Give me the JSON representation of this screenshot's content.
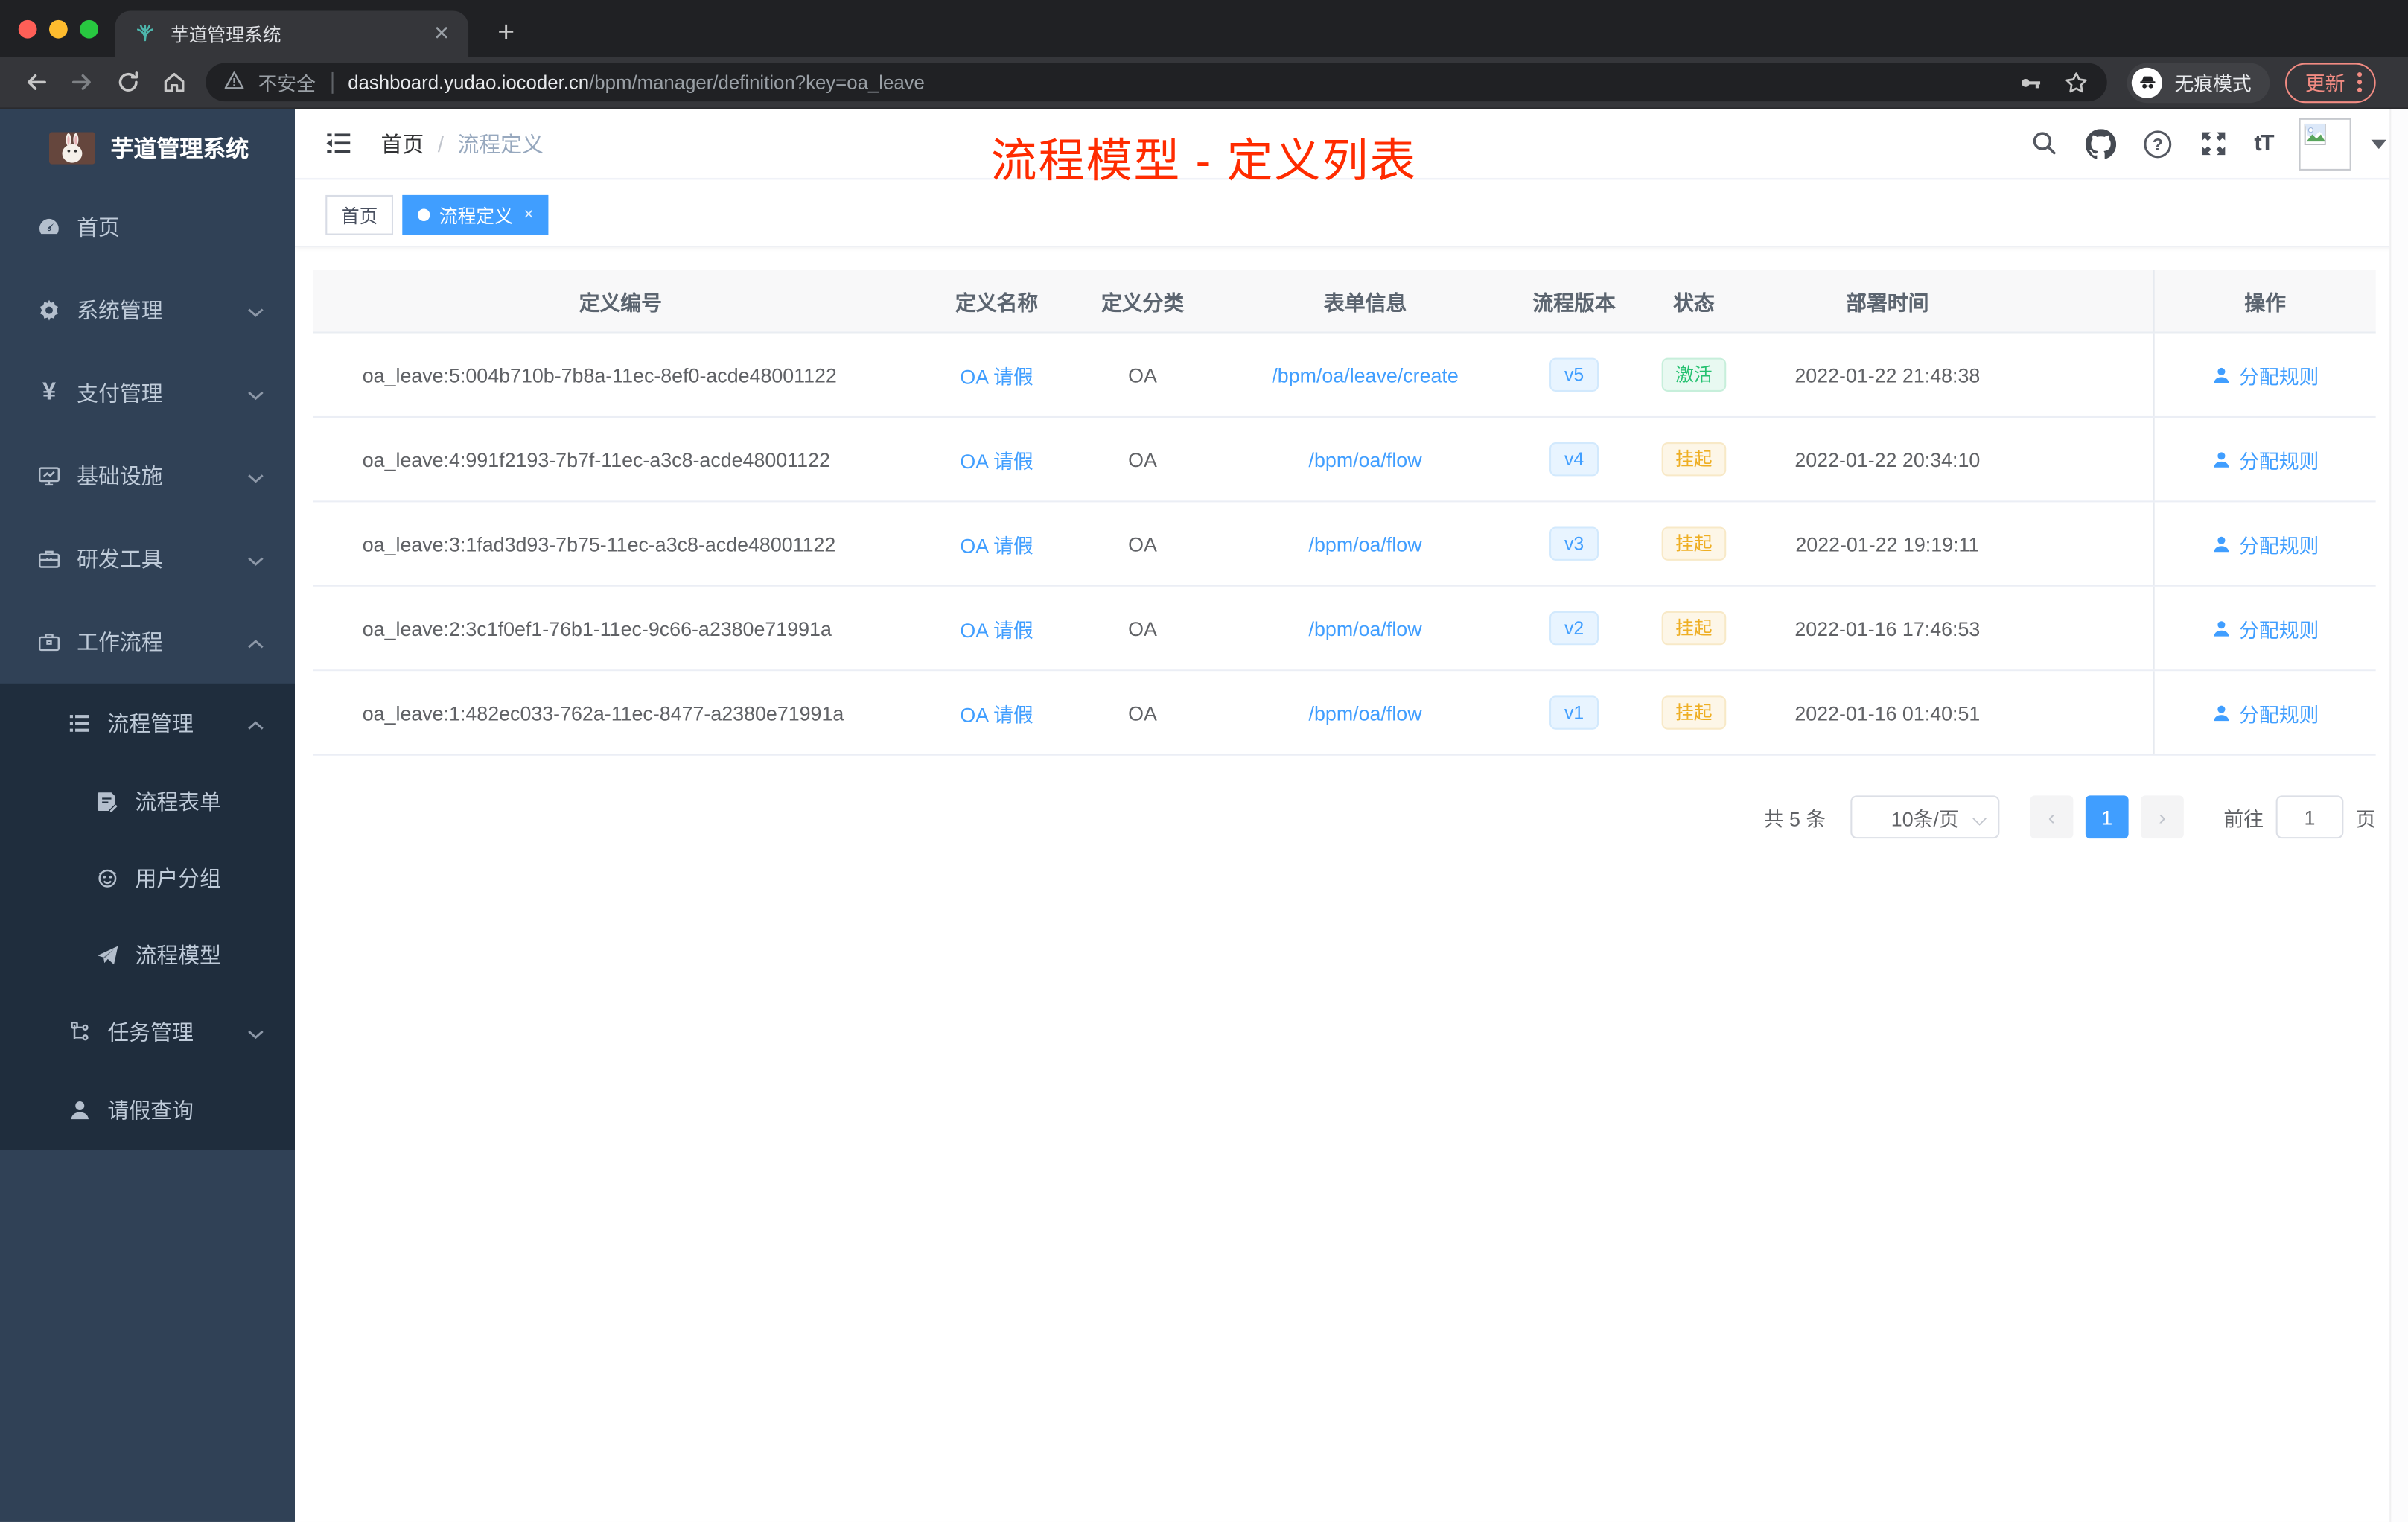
{
  "browser": {
    "tab_title": "芋道管理系统",
    "new_tab_label": "+",
    "close_tab_label": "✕",
    "security_label": "不安全",
    "url_host": "dashboard.yudao.iocoder.cn",
    "url_path": "/bpm/manager/definition?key=oa_leave",
    "incognito_label": "无痕模式",
    "update_label": "更新"
  },
  "sidebar": {
    "logo_title": "芋道管理系统",
    "items": [
      {
        "label": "首页",
        "icon": "dashboard-icon"
      },
      {
        "label": "系统管理",
        "icon": "gear-icon"
      },
      {
        "label": "支付管理",
        "icon": "yen-icon"
      },
      {
        "label": "基础设施",
        "icon": "monitor-icon"
      },
      {
        "label": "研发工具",
        "icon": "toolbox-icon"
      },
      {
        "label": "工作流程",
        "icon": "briefcase-icon"
      }
    ],
    "workflow_children": [
      {
        "label": "流程管理",
        "icon": "tree-list-icon"
      },
      {
        "label": "流程表单",
        "icon": "form-edit-icon"
      },
      {
        "label": "用户分组",
        "icon": "user-group-icon"
      },
      {
        "label": "流程模型",
        "icon": "paper-plane-icon"
      },
      {
        "label": "任务管理",
        "icon": "org-tree-icon"
      },
      {
        "label": "请假查询",
        "icon": "person-icon"
      }
    ]
  },
  "header": {
    "breadcrumb_home": "首页",
    "breadcrumb_sep": "/",
    "breadcrumb_current": "流程定义",
    "annotation": "流程模型 - 定义列表",
    "font_size_icon_text": "tT"
  },
  "tags": {
    "home": "首页",
    "active": "流程定义",
    "active_close": "×"
  },
  "table": {
    "columns": [
      "定义编号",
      "定义名称",
      "定义分类",
      "表单信息",
      "流程版本",
      "状态",
      "部署时间",
      "操作"
    ],
    "rows": [
      {
        "id": "oa_leave:5:004b710b-7b8a-11ec-8ef0-acde48001122",
        "name": "OA 请假",
        "category": "OA",
        "form": "/bpm/oa/leave/create",
        "version": "v5",
        "status": "激活",
        "status_type": "success",
        "deployed": "2022-01-22 21:48:38",
        "action": "分配规则"
      },
      {
        "id": "oa_leave:4:991f2193-7b7f-11ec-a3c8-acde48001122",
        "name": "OA 请假",
        "category": "OA",
        "form": "/bpm/oa/flow",
        "version": "v4",
        "status": "挂起",
        "status_type": "warning",
        "deployed": "2022-01-22 20:34:10",
        "action": "分配规则"
      },
      {
        "id": "oa_leave:3:1fad3d93-7b75-11ec-a3c8-acde48001122",
        "name": "OA 请假",
        "category": "OA",
        "form": "/bpm/oa/flow",
        "version": "v3",
        "status": "挂起",
        "status_type": "warning",
        "deployed": "2022-01-22 19:19:11",
        "action": "分配规则"
      },
      {
        "id": "oa_leave:2:3c1f0ef1-76b1-11ec-9c66-a2380e71991a",
        "name": "OA 请假",
        "category": "OA",
        "form": "/bpm/oa/flow",
        "version": "v2",
        "status": "挂起",
        "status_type": "warning",
        "deployed": "2022-01-16 17:46:53",
        "action": "分配规则"
      },
      {
        "id": "oa_leave:1:482ec033-762a-11ec-8477-a2380e71991a",
        "name": "OA 请假",
        "category": "OA",
        "form": "/bpm/oa/flow",
        "version": "v1",
        "status": "挂起",
        "status_type": "warning",
        "deployed": "2022-01-16 01:40:51",
        "action": "分配规则"
      }
    ]
  },
  "pagination": {
    "total": "共 5 条",
    "page_size": "10条/页",
    "prev": "‹",
    "current": "1",
    "next": "›",
    "goto_label": "前往",
    "goto_value": "1",
    "page_label": "页"
  },
  "colors": {
    "accent": "#409eff",
    "annotation_red": "#ff2b00",
    "sidebar_bg": "#304156",
    "submenu_bg": "#1f2d3d",
    "status_active_green": "#25c170",
    "status_suspend_yellow": "#eeae23"
  }
}
